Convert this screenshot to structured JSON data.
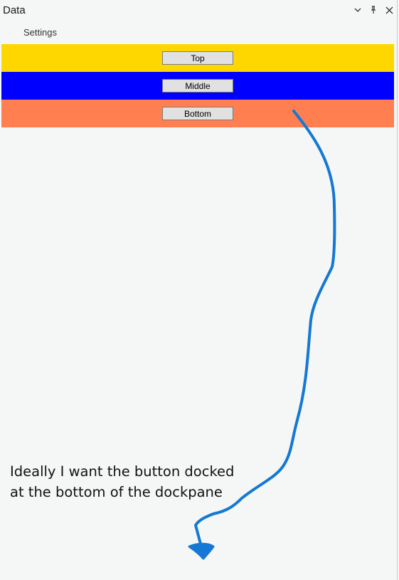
{
  "window": {
    "title": "Data",
    "controls": {
      "dropdown_icon": "chevron-down-icon",
      "pin_icon": "pin-icon",
      "close_icon": "close-icon"
    }
  },
  "tabs": {
    "settings_label": "Settings"
  },
  "panels": [
    {
      "name": "top",
      "color": "#FFD700",
      "button_label": "Top"
    },
    {
      "name": "middle",
      "color": "#0000FF",
      "button_label": "Middle"
    },
    {
      "name": "bottom",
      "color": "#FF7F50",
      "button_label": "Bottom"
    }
  ],
  "annotation": {
    "line1": "Ideally I want the button docked",
    "line2": "at the bottom of the dockpane",
    "arrow_color": "#1478d4"
  }
}
